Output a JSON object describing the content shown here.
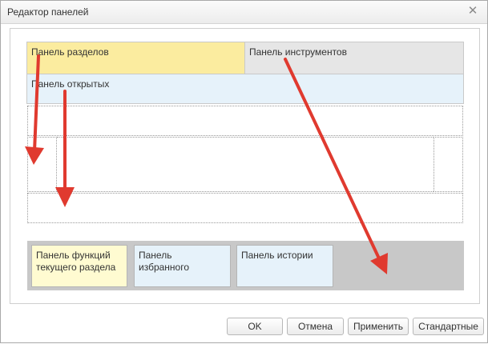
{
  "window": {
    "title": "Редактор панелей",
    "close_icon": "close-icon"
  },
  "panels": {
    "sections": {
      "label": "Панель разделов",
      "color": "#fbec9f"
    },
    "tools": {
      "label": "Панель инструментов",
      "color": "#e6e6e6"
    },
    "open": {
      "label": "Панель открытых",
      "color": "#e6f2fa"
    },
    "functions": {
      "label": "Панель функций\nтекущего раздела",
      "color": "#fffbd1"
    },
    "favorites": {
      "label": "Панель\nизбранного",
      "color": "#e6f2fa"
    },
    "history": {
      "label": "Панель истории",
      "color": "#e6f2fa"
    },
    "bottom_area_color": "#c8c8c8"
  },
  "annotations": {
    "arrow_color": "#e03a2f",
    "arrow_count": 4
  },
  "buttons": {
    "ok": "OK",
    "cancel": "Отмена",
    "apply": "Применить",
    "default": "Стандартные"
  }
}
